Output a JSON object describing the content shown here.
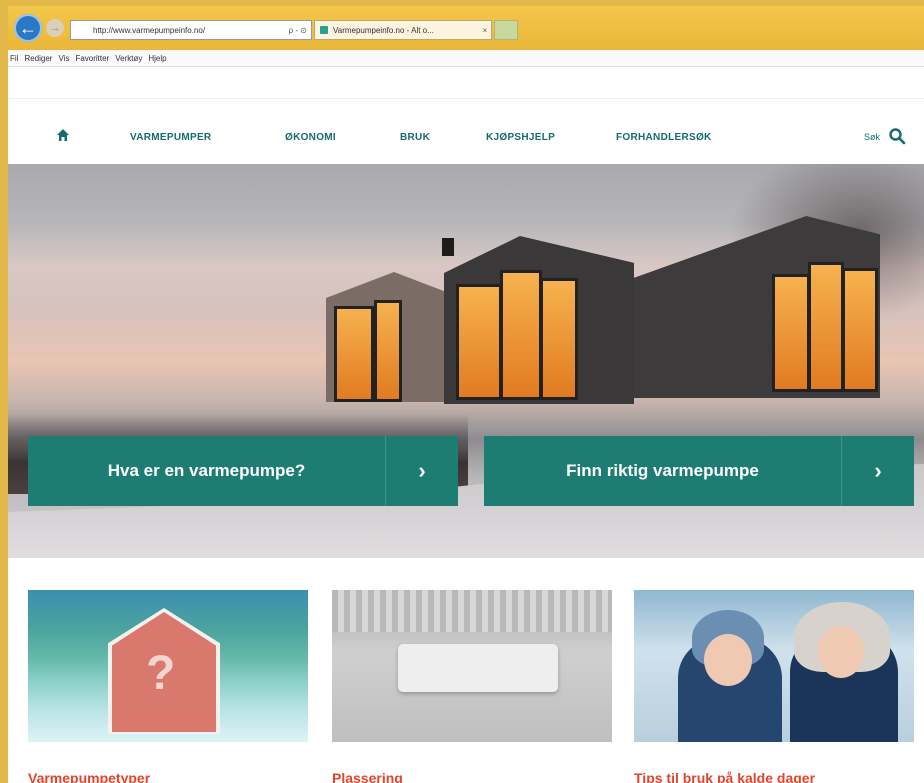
{
  "browser": {
    "back_icon": "arrow-left-icon",
    "address_url": "http://www.varmepumpeinfo.no/",
    "address_controls": "ρ - ⊙",
    "tab_title": "Varmepumpeinfo.no - Alt o...",
    "tab_close": "×",
    "menu": [
      "Fil",
      "Rediger",
      "Vis",
      "Favoritter",
      "Verktøy",
      "Hjelp"
    ]
  },
  "site_nav": {
    "home_icon": "home-icon",
    "links": [
      "VARMEPUMPER",
      "ØKONOMI",
      "BRUK",
      "KJØPSHJELP",
      "FORHANDLERSØK"
    ],
    "search_label": "Søk",
    "search_icon": "search-icon"
  },
  "hero": {
    "cta_left": "Hva er en varmepumpe?",
    "cta_right": "Finn riktig varmepumpe",
    "arrow_glyph": "›"
  },
  "cards": [
    {
      "title": "Varmepumpetyper"
    },
    {
      "title": "Plassering"
    },
    {
      "title": "Tips til bruk på kalde dager"
    }
  ],
  "colors": {
    "brand_teal": "#1d7d73",
    "nav_teal": "#156b6e",
    "accent_red": "#e1452e"
  }
}
